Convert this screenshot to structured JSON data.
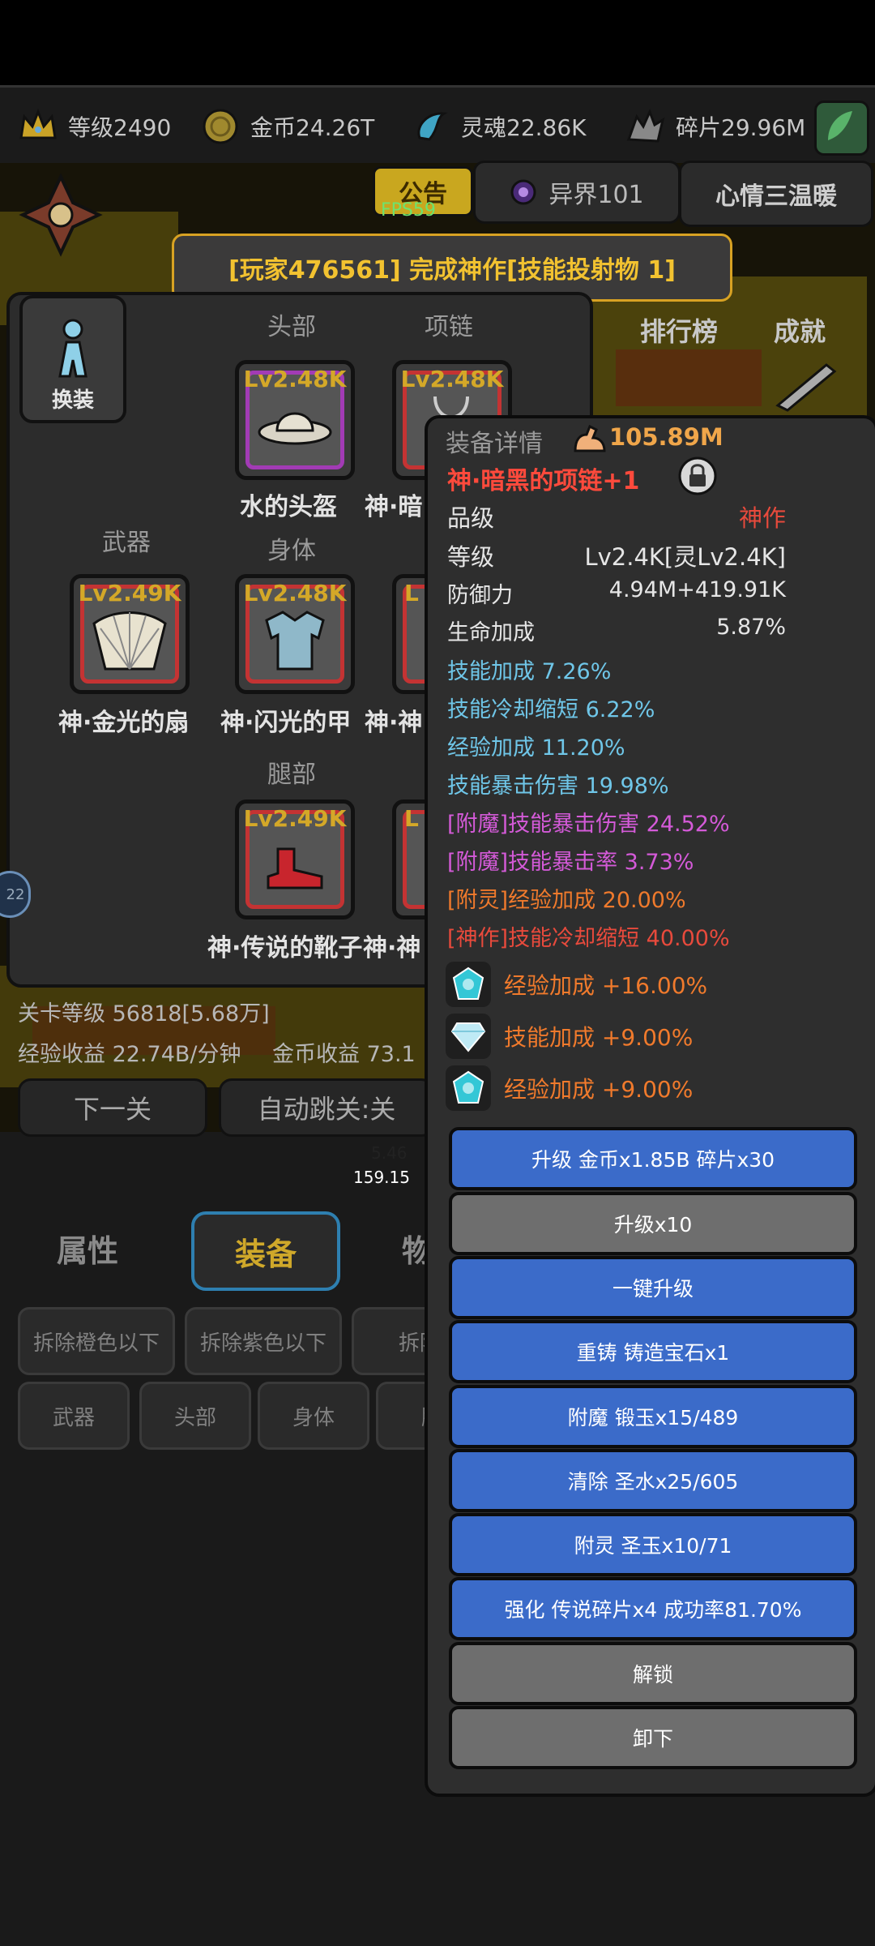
{
  "resources": [
    {
      "name": "level",
      "label": "等级2490",
      "icon": "crown-icon"
    },
    {
      "name": "gold",
      "label": "金币24.26T",
      "icon": "gold-coin-icon"
    },
    {
      "name": "soul",
      "label": "灵魂22.86K",
      "icon": "soul-icon"
    },
    {
      "name": "shard",
      "label": "碎片29.96M",
      "icon": "shard-icon"
    }
  ],
  "header": {
    "announcement": "公告",
    "fps": "FPS59",
    "otherworld": "异界101",
    "mood": "心情三温暖"
  },
  "banner": "[玩家476561] 完成神作[技能投射物 1]",
  "side_buttons": {
    "ranking": "排行榜",
    "achievement": "成就"
  },
  "equipment": {
    "change_label": "换装",
    "labels": {
      "head": "头部",
      "necklace": "项链",
      "weapon": "武器",
      "body": "身体",
      "legs": "腿部"
    },
    "items": [
      {
        "slot": "head",
        "lv": "Lv2.48K",
        "name": "水的头盔",
        "icon": "hat-icon"
      },
      {
        "slot": "necklace",
        "lv": "Lv2.48K",
        "name": "神·暗",
        "icon": "necklace-icon"
      },
      {
        "slot": "weapon",
        "lv": "Lv2.49K",
        "name": "神·金光的扇",
        "icon": "fan-icon"
      },
      {
        "slot": "body",
        "lv": "Lv2.48K",
        "name": "神·闪光的甲",
        "icon": "armor-icon"
      },
      {
        "slot": "body2",
        "lv": "L",
        "name": "神·神",
        "icon": "ring-icon"
      },
      {
        "slot": "legs",
        "lv": "Lv2.49K",
        "name": "神·传说的靴子",
        "icon": "boot-icon"
      },
      {
        "slot": "legs2",
        "lv": "L",
        "name": "神·神",
        "icon": "accessory-icon"
      }
    ]
  },
  "stage": {
    "stage_level": "关卡等级 56818[5.68万]",
    "exp_income": "经验收益 22.74B/分钟",
    "gold_income": "金币收益 73.1",
    "next_stage": "下一关",
    "auto_skip": "自动跳关:关",
    "bar1": "5.46",
    "bar2": "159.15"
  },
  "tabs": [
    {
      "label": "属性",
      "active": false
    },
    {
      "label": "装备",
      "active": true
    },
    {
      "label": "物",
      "active": false
    }
  ],
  "dismantle": [
    "拆除橙色以下",
    "拆除紫色以下",
    "拆除所"
  ],
  "filters": [
    "武器",
    "头部",
    "身体",
    "腿"
  ],
  "side_badge": "22",
  "detail": {
    "title": "装备详情",
    "power": "105.89M",
    "item_name": "神·暗黑的项链+1",
    "stats": [
      {
        "label": "品级",
        "value": "神作",
        "value_color": "#e84a3c"
      },
      {
        "label": "等级",
        "value": "Lv2.4K[灵Lv2.4K]",
        "value_color": "#e6e6e6"
      },
      {
        "label": "防御力",
        "value": "4.94M+419.91K",
        "value_color": "#e6e6e6"
      },
      {
        "label": "生命加成",
        "value": "5.87%",
        "value_color": "#e6e6e6"
      }
    ],
    "bonuses": [
      {
        "text": "技能加成 7.26%",
        "color": "#6fc6e8"
      },
      {
        "text": "技能冷却缩短 6.22%",
        "color": "#6fc6e8"
      },
      {
        "text": "经验加成 11.20%",
        "color": "#6fc6e8"
      },
      {
        "text": "技能暴击伤害 19.98%",
        "color": "#6fc6e8"
      },
      {
        "text": "[附魔]技能暴击伤害 24.52%",
        "color": "#d45ad8"
      },
      {
        "text": "[附魔]技能暴击率 3.73%",
        "color": "#d45ad8"
      },
      {
        "text": "[附灵]经验加成 20.00%",
        "color": "#f07a2c"
      },
      {
        "text": "[神作]技能冷却缩短 40.00%",
        "color": "#e84a3c"
      }
    ],
    "gems": [
      {
        "text": "经验加成 +16.00%",
        "icon": "gem-cyan-icon"
      },
      {
        "text": "技能加成 +9.00%",
        "icon": "gem-diamond-icon"
      },
      {
        "text": "经验加成 +9.00%",
        "icon": "gem-cyan-icon"
      }
    ],
    "buttons": [
      {
        "label": "升级 金币x1.85B 碎片x30",
        "style": "blue"
      },
      {
        "label": "升级x10",
        "style": "gray"
      },
      {
        "label": "一键升级",
        "style": "blue"
      },
      {
        "label": "重铸 铸造宝石x1",
        "style": "blue"
      },
      {
        "label": "附魔 锻玉x15/489",
        "style": "blue"
      },
      {
        "label": "清除 圣水x25/605",
        "style": "blue"
      },
      {
        "label": "附灵 圣玉x10/71",
        "style": "blue"
      },
      {
        "label": "强化 传说碎片x4 成功率81.70%",
        "style": "blue"
      },
      {
        "label": "解锁",
        "style": "gray"
      },
      {
        "label": "卸下",
        "style": "gray"
      }
    ]
  }
}
